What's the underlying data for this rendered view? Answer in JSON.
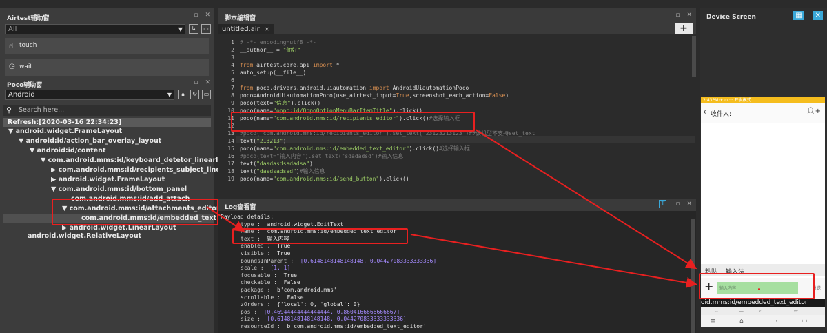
{
  "airtest_panel": {
    "title": "Airtest辅助窗",
    "filter_value": "All",
    "items": [
      {
        "label": "touch",
        "icon": "hand-pointer-icon"
      },
      {
        "label": "wait",
        "icon": "clock-icon"
      }
    ]
  },
  "poco_panel": {
    "title": "Poco辅助窗",
    "mode_value": "Android",
    "search_placeholder": "Search here...",
    "refresh_label": "Refresh:[2020-03-16 22:34:23]",
    "tree": [
      {
        "text": "android.widget.FrameLayout",
        "arrow": "▼"
      },
      {
        "text": "android:id/action_bar_overlay_layout",
        "arrow": "▼"
      },
      {
        "text": "android:id/content",
        "arrow": "▼"
      },
      {
        "text": "com.android.mms:id/keyboard_detetor_linearla...",
        "arrow": "▼"
      },
      {
        "text": "com.android.mms:id/recipients_subject_linear",
        "arrow": "▶"
      },
      {
        "text": "android.widget.FrameLayout",
        "arrow": "▶"
      },
      {
        "text": "com.android.mms:id/bottom_panel",
        "arrow": "▼"
      },
      {
        "text": "com.android.mms:id/add_attach",
        "arrow": ""
      },
      {
        "text": "com.android.mms:id/attachments_editor",
        "arrow": "▼"
      },
      {
        "text": "com.android.mms:id/embedded_text...",
        "arrow": ""
      },
      {
        "text": "android.widget.LinearLayout",
        "arrow": "▶"
      },
      {
        "text": "android.widget.RelativeLayout",
        "arrow": ""
      }
    ]
  },
  "script_panel": {
    "title": "脚本编辑窗",
    "tab_label": "untitled.air",
    "tab_close": "✕",
    "add_label": "+",
    "lines": [
      {
        "n": "1",
        "parts": [
          {
            "t": "# -*- encoding=utf8 -*-",
            "c": "cm"
          }
        ]
      },
      {
        "n": "2",
        "parts": [
          {
            "t": "__author__ = ",
            "c": ""
          },
          {
            "t": "\"你好\"",
            "c": "str"
          }
        ]
      },
      {
        "n": "3",
        "parts": []
      },
      {
        "n": "4",
        "parts": [
          {
            "t": "from",
            "c": "kw"
          },
          {
            "t": " airtest.core.api ",
            "c": ""
          },
          {
            "t": "import",
            "c": "kw"
          },
          {
            "t": " *",
            "c": ""
          }
        ]
      },
      {
        "n": "5",
        "parts": [
          {
            "t": "auto_setup(__file__)",
            "c": ""
          }
        ]
      },
      {
        "n": "6",
        "parts": []
      },
      {
        "n": "7",
        "parts": [
          {
            "t": "from",
            "c": "kw"
          },
          {
            "t": " poco.drivers.android.uiautomation ",
            "c": ""
          },
          {
            "t": "import",
            "c": "kw"
          },
          {
            "t": " AndroidUiautomationPoco",
            "c": ""
          }
        ]
      },
      {
        "n": "8",
        "parts": [
          {
            "t": "poco=AndroidUiautomationPoco(use_airtest_input=",
            "c": ""
          },
          {
            "t": "True",
            "c": "kw"
          },
          {
            "t": ",screenshot_each_action=",
            "c": ""
          },
          {
            "t": "False",
            "c": "kw"
          },
          {
            "t": ")",
            "c": ""
          }
        ]
      },
      {
        "n": "9",
        "parts": [
          {
            "t": "poco(text=",
            "c": ""
          },
          {
            "t": "\"信息\"",
            "c": "str"
          },
          {
            "t": ").click()",
            "c": ""
          }
        ]
      },
      {
        "n": "10",
        "parts": [
          {
            "t": "poco(name=",
            "c": ""
          },
          {
            "t": "\"oppo:id/OppoOptionMenuBarItemTitle\"",
            "c": "str"
          },
          {
            "t": ").click()",
            "c": ""
          }
        ]
      },
      {
        "n": "11",
        "parts": [
          {
            "t": "poco(name=",
            "c": ""
          },
          {
            "t": "\"com.android.mms:id/recipients_editor\"",
            "c": "str"
          },
          {
            "t": ").click()",
            "c": ""
          },
          {
            "t": "#选择输入框",
            "c": "cm"
          }
        ]
      },
      {
        "n": "12",
        "parts": []
      },
      {
        "n": "13",
        "parts": [
          {
            "t": "#poco(\"com.android.mms:id/recipients_editor\").set_text(\"23123213123\")##该机型不支持set_text",
            "c": "cm"
          }
        ]
      },
      {
        "n": "14",
        "parts": [
          {
            "t": "text(",
            "c": ""
          },
          {
            "t": "\"213213\"",
            "c": "str"
          },
          {
            "t": ")",
            "c": ""
          }
        ]
      },
      {
        "n": "15",
        "parts": [
          {
            "t": "poco(name=",
            "c": ""
          },
          {
            "t": "\"com.android.mms:id/embedded_text_editor\"",
            "c": "str"
          },
          {
            "t": ").click()",
            "c": ""
          },
          {
            "t": "#选择输入框",
            "c": "cm"
          }
        ]
      },
      {
        "n": "16",
        "parts": [
          {
            "t": "#poco(text=\"输入内容\").set_text(\"sdadadsd\")#输入信息",
            "c": "cm"
          }
        ]
      },
      {
        "n": "17",
        "parts": [
          {
            "t": "text(",
            "c": ""
          },
          {
            "t": "\"dasdasdsadadsa\"",
            "c": "str"
          },
          {
            "t": ")",
            "c": ""
          }
        ]
      },
      {
        "n": "18",
        "parts": [
          {
            "t": "text(",
            "c": ""
          },
          {
            "t": "\"dasdsadsad\"",
            "c": "str"
          },
          {
            "t": ")",
            "c": ""
          },
          {
            "t": "#输入信息",
            "c": "cm"
          }
        ]
      },
      {
        "n": "19",
        "parts": [
          {
            "t": "poco(name=",
            "c": ""
          },
          {
            "t": "\"com.android.mms:id/send_button\"",
            "c": "str"
          },
          {
            "t": ").click()",
            "c": ""
          }
        ]
      }
    ]
  },
  "log_panel": {
    "title": "Log查看窗",
    "header": "Payload details:",
    "fields": [
      {
        "k": "type :",
        "v": "android.widget.EditText",
        "num": false
      },
      {
        "k": "name :",
        "v": "com.android.mms:id/embedded_text_editor",
        "num": false
      },
      {
        "k": "text :",
        "v": "输入内容",
        "num": false
      },
      {
        "k": "enabled :",
        "v": "True",
        "num": false
      },
      {
        "k": "visible :",
        "v": "True",
        "num": false
      },
      {
        "k": "boundsInParent :",
        "v": "[0.6148148148148148, 0.04427083333333336]",
        "num": true
      },
      {
        "k": "scale :",
        "v": "[1, 1]",
        "num": true
      },
      {
        "k": "focusable :",
        "v": "True",
        "num": false
      },
      {
        "k": "checkable :",
        "v": "False",
        "num": false
      },
      {
        "k": "package :",
        "v": "b'com.android.mms'",
        "num": false
      },
      {
        "k": "scrollable :",
        "v": "False",
        "num": false
      },
      {
        "k": "zOrders :",
        "v": "{'local': 0, 'global': 0}",
        "num": false
      },
      {
        "k": "pos :",
        "v": "[0.46944444444444444, 0.8604166666666667]",
        "num": true
      },
      {
        "k": "size :",
        "v": "[0.6148148148148148, 0.044270833333333336]",
        "num": true
      },
      {
        "k": "resourceId :",
        "v": "b'com.android.mms:id/embedded_text_editor'",
        "num": false
      }
    ]
  },
  "device_panel": {
    "title": "Device Screen",
    "status_text": "2:43PM ✈ ⊙ ··· 开发模式",
    "recipient_label": "收件人:",
    "paste_label": "粘贴",
    "input_method_label": "输入法",
    "input_placeholder": "输入内容",
    "send_label": "发送",
    "overlay_text": "oid.mms:id/embedded_text_editor"
  },
  "colors": {
    "accent_yellow": "#f5bd1e",
    "selected_input_green": "#a6dfa0",
    "annotation_red": "#e82020",
    "code_keyword": "#d88f51",
    "code_string": "#9ccc65"
  }
}
